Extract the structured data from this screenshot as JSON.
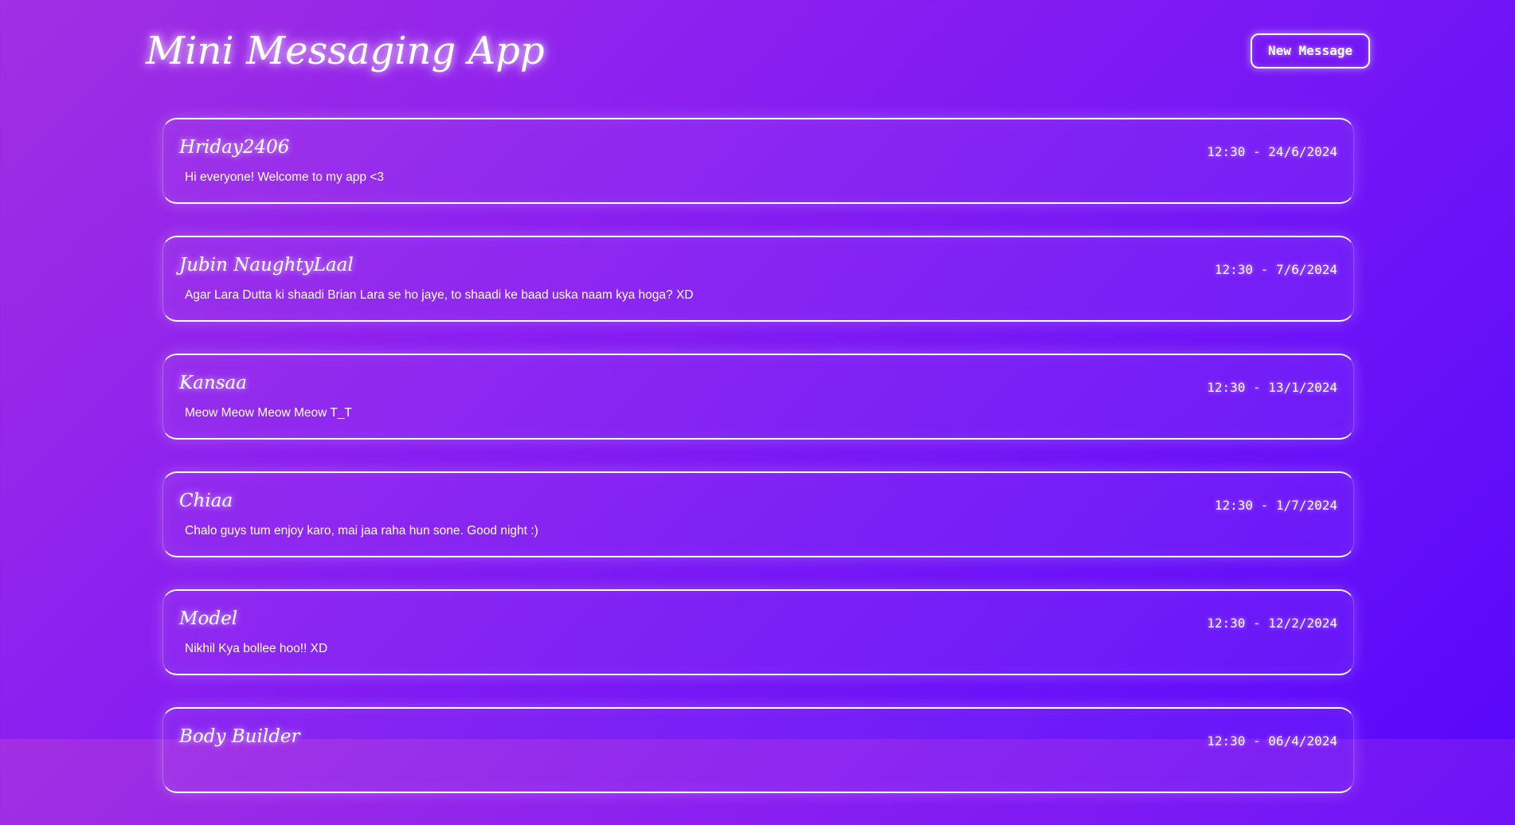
{
  "header": {
    "title": "Mini Messaging App",
    "new_message_label": "New Message"
  },
  "messages": [
    {
      "sender": "Hriday2406",
      "timestamp": "12:30 - 24/6/2024",
      "text": "Hi everyone! Welcome to my app <3"
    },
    {
      "sender": "Jubin NaughtyLaal",
      "timestamp": "12:30 - 7/6/2024",
      "text": "Agar Lara Dutta ki shaadi Brian Lara se ho jaye, to shaadi ke baad uska naam kya hoga? XD"
    },
    {
      "sender": "Kansaa",
      "timestamp": "12:30 - 13/1/2024",
      "text": "Meow Meow Meow Meow T_T"
    },
    {
      "sender": "Chiaa",
      "timestamp": "12:30 - 1/7/2024",
      "text": "Chalo guys tum enjoy karo, mai jaa raha hun sone. Good night :)"
    },
    {
      "sender": "Model",
      "timestamp": "12:30 - 12/2/2024",
      "text": "Nikhil Kya bollee hoo!! XD"
    },
    {
      "sender": "Body Builder",
      "timestamp": "12:30 - 06/4/2024",
      "text": ""
    }
  ]
}
